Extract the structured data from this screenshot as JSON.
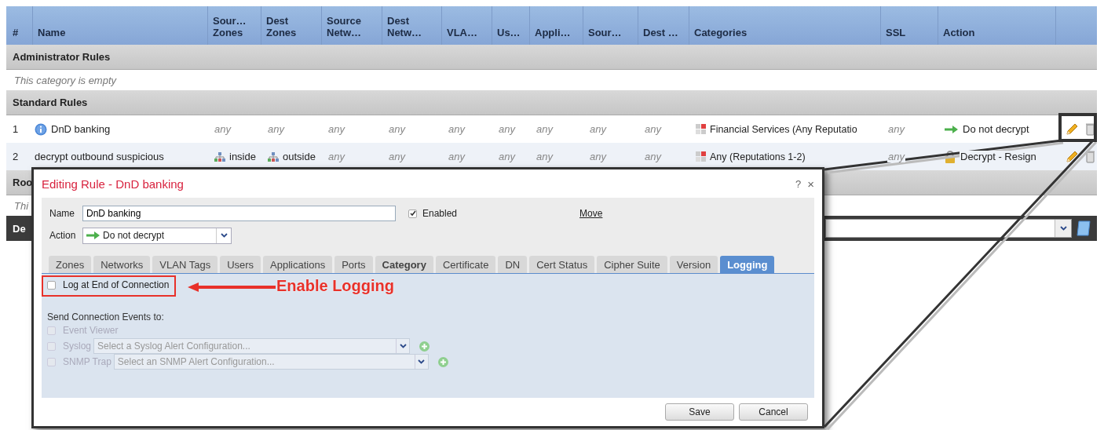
{
  "table": {
    "columns": [
      "#",
      "Name",
      "Sour… Zones",
      "Dest Zones",
      "Source Netw…",
      "Dest Netw…",
      "VLA…",
      "Us…",
      "Appli…",
      "Sour…",
      "Dest …",
      "Categories",
      "SSL",
      "Action"
    ],
    "sections": [
      {
        "title": "Administrator Rules",
        "empty_text": "This category is empty"
      },
      {
        "title": "Standard Rules",
        "rows": [
          {
            "number": "1",
            "name": "DnD banking",
            "info": true,
            "cells": [
              {
                "text": "any",
                "kind": "any"
              },
              {
                "text": "any",
                "kind": "any"
              },
              {
                "text": "any",
                "kind": "any"
              },
              {
                "text": "any",
                "kind": "any"
              },
              {
                "text": "any",
                "kind": "any"
              },
              {
                "text": "any",
                "kind": "any"
              },
              {
                "text": "any",
                "kind": "any"
              },
              {
                "text": "any",
                "kind": "any"
              },
              {
                "text": "any",
                "kind": "any"
              }
            ],
            "category": "Financial Services (Any Reputatio",
            "ssl": "any",
            "action": {
              "text": "Do not decrypt",
              "kind": "do-not-decrypt"
            }
          },
          {
            "number": "2",
            "name": "decrypt outbound suspicious",
            "info": false,
            "cells": [
              {
                "text": "inside",
                "kind": "zone"
              },
              {
                "text": "outside",
                "kind": "zone"
              },
              {
                "text": "any",
                "kind": "any"
              },
              {
                "text": "any",
                "kind": "any"
              },
              {
                "text": "any",
                "kind": "any"
              },
              {
                "text": "any",
                "kind": "any"
              },
              {
                "text": "any",
                "kind": "any"
              },
              {
                "text": "any",
                "kind": "any"
              },
              {
                "text": "any",
                "kind": "any"
              }
            ],
            "category": "Any (Reputations 1-2)",
            "ssl": "any",
            "action": {
              "text": "Decrypt - Resign",
              "kind": "decrypt-resign"
            }
          }
        ]
      },
      {
        "title": "Roo",
        "empty_text": "Thi"
      }
    ],
    "default_action": {
      "label": "De"
    }
  },
  "dialog": {
    "title": "Editing Rule - DnD banking",
    "help": "?",
    "close": "×",
    "name_label": "Name",
    "name_value": "DnD banking",
    "enabled": {
      "label": "Enabled",
      "checked": true
    },
    "move_link": "Move",
    "action_label": "Action",
    "action_value": "Do not decrypt",
    "tabs": [
      {
        "label": "Zones",
        "selected": false,
        "modified": false
      },
      {
        "label": "Networks",
        "selected": false,
        "modified": false
      },
      {
        "label": "VLAN Tags",
        "selected": false,
        "modified": false
      },
      {
        "label": "Users",
        "selected": false,
        "modified": false
      },
      {
        "label": "Applications",
        "selected": false,
        "modified": false
      },
      {
        "label": "Ports",
        "selected": false,
        "modified": false
      },
      {
        "label": "Category",
        "selected": false,
        "modified": true
      },
      {
        "label": "Certificate",
        "selected": false,
        "modified": false
      },
      {
        "label": "DN",
        "selected": false,
        "modified": false
      },
      {
        "label": "Cert Status",
        "selected": false,
        "modified": false
      },
      {
        "label": "Cipher Suite",
        "selected": false,
        "modified": false
      },
      {
        "label": "Version",
        "selected": false,
        "modified": false
      },
      {
        "label": "Logging",
        "selected": true,
        "modified": false
      }
    ],
    "log_end": {
      "label": "Log at End of Connection",
      "checked": false
    },
    "send_label": "Send Connection Events to:",
    "destinations": [
      {
        "kind": "checkbox",
        "label": "Event Viewer",
        "checked": false,
        "disabled": true
      },
      {
        "kind": "select",
        "label": "Syslog",
        "placeholder": "Select a Syslog Alert Configuration...",
        "checked": false,
        "disabled": true
      },
      {
        "kind": "select",
        "label": "SNMP Trap",
        "placeholder": "Select an SNMP Alert Configuration...",
        "checked": false,
        "disabled": true
      }
    ],
    "buttons": [
      "Save",
      "Cancel"
    ]
  },
  "annotation": {
    "text": "Enable Logging"
  }
}
